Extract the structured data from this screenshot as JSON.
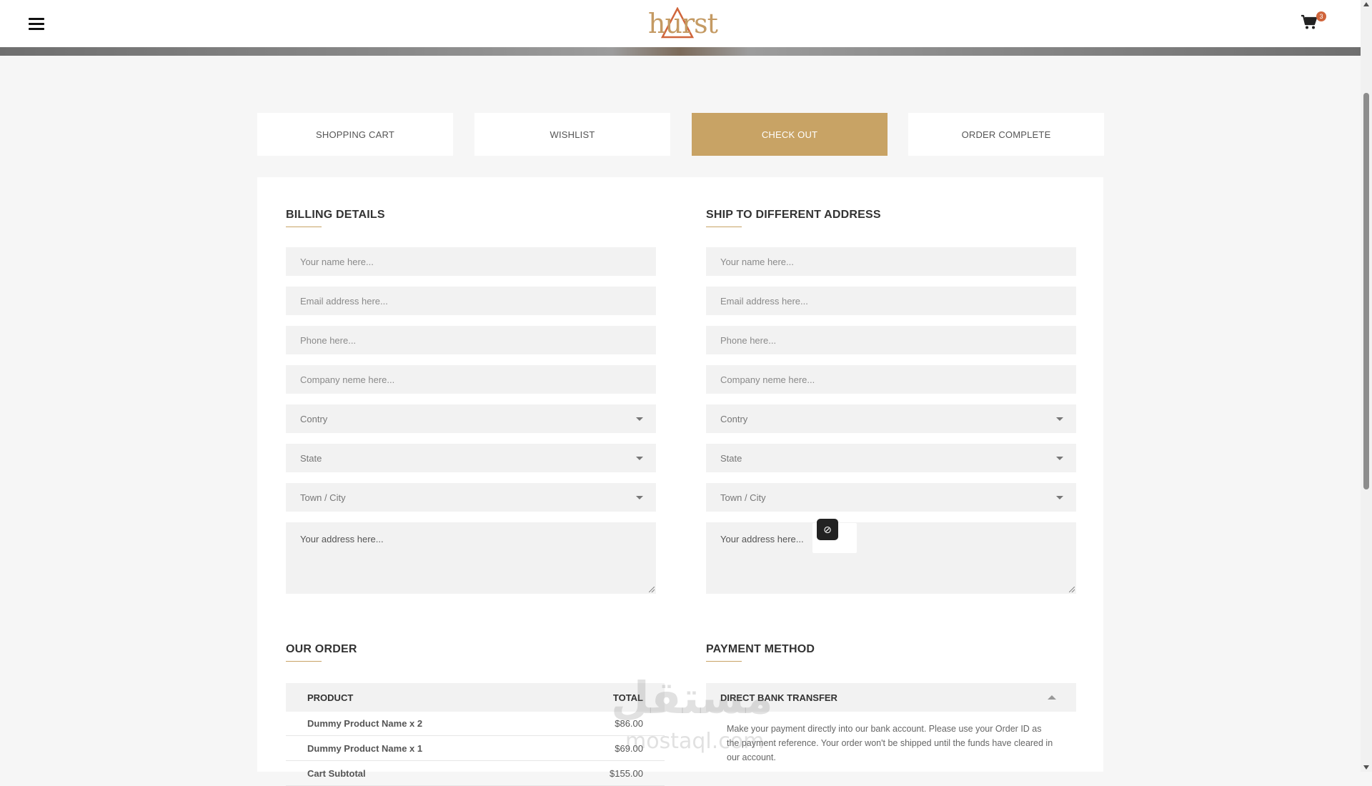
{
  "header": {
    "logo_text": "hurst",
    "cart_count": "3"
  },
  "tabs": [
    {
      "label": "SHOPPING CART"
    },
    {
      "label": "WISHLIST"
    },
    {
      "label": "CHECK OUT"
    },
    {
      "label": "ORDER COMPLETE"
    }
  ],
  "billing": {
    "title": "BILLING DETAILS",
    "name_placeholder": "Your name here...",
    "email_placeholder": "Email address here...",
    "phone_placeholder": "Phone here...",
    "company_placeholder": "Company neme here...",
    "country": "Contry",
    "state": "State",
    "city": "Town / City",
    "address_placeholder": "Your address here..."
  },
  "shipping": {
    "title": "SHIP TO DIFFERENT ADDRESS",
    "name_placeholder": "Your name here...",
    "email_placeholder": "Email address here...",
    "phone_placeholder": "Phone here...",
    "company_placeholder": "Company neme here...",
    "country": "Contry",
    "state": "State",
    "city": "Town / City",
    "address_placeholder": "Your address here..."
  },
  "order": {
    "title": "OUR ORDER",
    "col_product": "PRODUCT",
    "col_total": "TOTAL",
    "rows": [
      {
        "name": "Dummy Product Name x 2",
        "price": "$86.00"
      },
      {
        "name": "Dummy Product Name x 1",
        "price": "$69.00"
      },
      {
        "name": "Cart Subtotal",
        "price": "$155.00"
      }
    ]
  },
  "payment": {
    "title": "PAYMENT METHOD",
    "method": "DIRECT BANK TRANSFER",
    "description": "Make your payment directly into our bank account. Please use your Order ID as the payment reference. Your order won't be shipped until the funds have cleared in our account."
  },
  "watermark": {
    "arabic": "مستقل",
    "latin": "mostaql.com"
  },
  "colors": {
    "accent": "#c8a365",
    "badge": "#d0653b",
    "field_bg": "#f2f2f2"
  }
}
